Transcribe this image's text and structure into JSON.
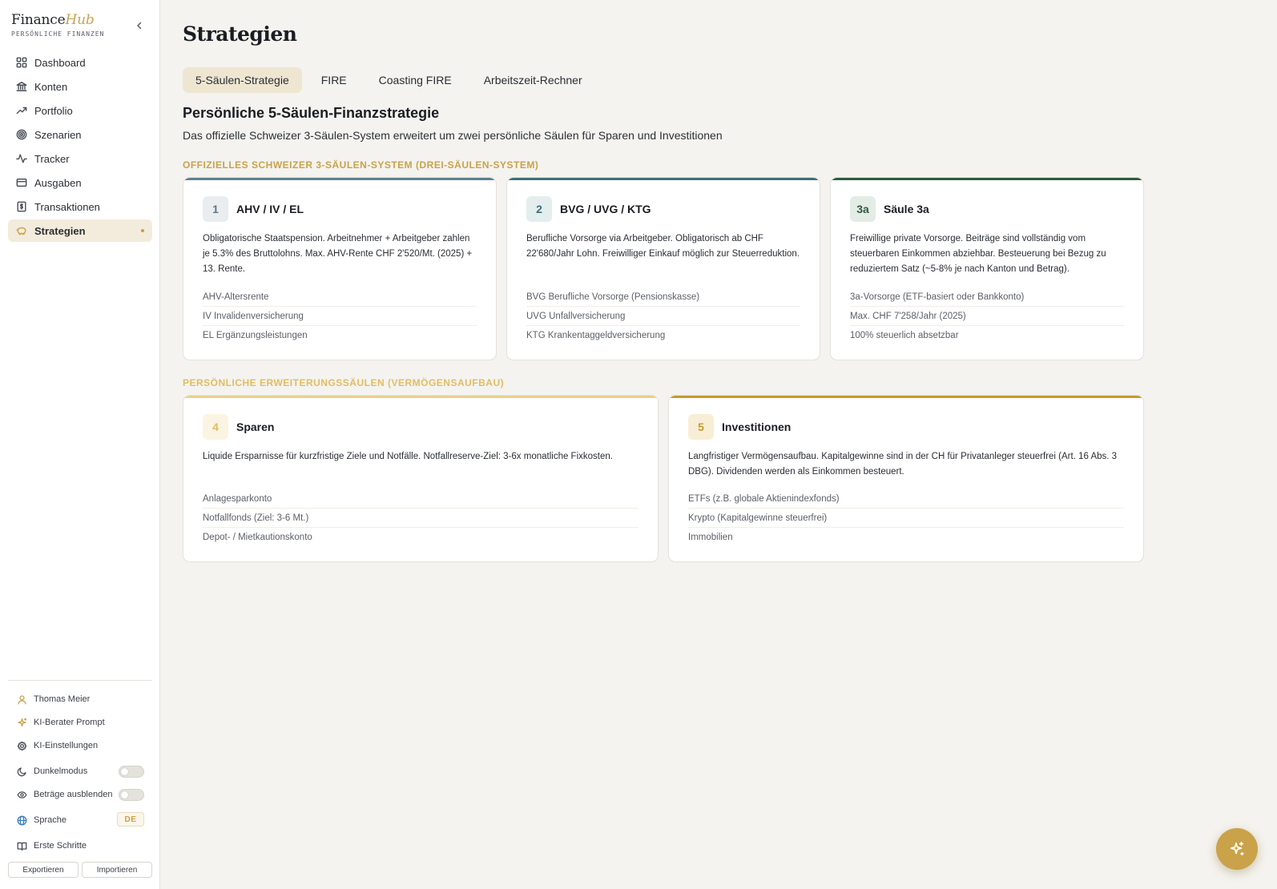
{
  "brand": {
    "name_plain": "Finance",
    "name_accent": "Hub",
    "tagline": "PERSÖNLICHE FINANZEN"
  },
  "nav": [
    {
      "label": "Dashboard",
      "icon": "dashboard-icon"
    },
    {
      "label": "Konten",
      "icon": "bank-icon"
    },
    {
      "label": "Portfolio",
      "icon": "trending-up-icon"
    },
    {
      "label": "Szenarien",
      "icon": "target-icon"
    },
    {
      "label": "Tracker",
      "icon": "activity-icon"
    },
    {
      "label": "Ausgaben",
      "icon": "credit-card-icon"
    },
    {
      "label": "Transaktionen",
      "icon": "receipt-icon"
    },
    {
      "label": "Strategien",
      "icon": "piggy-bank-icon",
      "active": true
    }
  ],
  "sidebar_bottom": {
    "user": "Thomas Meier",
    "ai_prompt": "KI-Berater Prompt",
    "ai_settings": "KI-Einstellungen",
    "dark_mode": "Dunkelmodus",
    "hide_amounts": "Beträge ausblenden",
    "language": "Sprache",
    "language_value": "DE",
    "getting_started": "Erste Schritte",
    "export": "Exportieren",
    "import": "Importieren"
  },
  "page": {
    "title": "Strategien",
    "tabs": [
      "5-Säulen-Strategie",
      "FIRE",
      "Coasting FIRE",
      "Arbeitszeit-Rechner"
    ],
    "active_tab": "5-Säulen-Strategie",
    "section_title": "Persönliche 5-Säulen-Finanzstrategie",
    "section_subtitle": "Das offizielle Schweizer 3-Säulen-System erweitert um zwei persönliche Säulen für Sparen und Investitionen"
  },
  "groups": {
    "official_label": "OFFIZIELLES SCHWEIZER 3-SÄULEN-SYSTEM (DREI-SÄULEN-SYSTEM)",
    "personal_label": "PERSÖNLICHE ERWEITERUNGSSÄULEN (VERMÖGENSAUFBAU)"
  },
  "pillars": [
    {
      "badge": "1",
      "title": "AHV / IV / EL",
      "description": "Obligatorische Staatspension. Arbeitnehmer + Arbeitgeber zahlen je 5.3% des Bruttolohns. Max. AHV-Rente CHF 2'520/Mt. (2025) + 13. Rente.",
      "items": [
        "AHV-Altersrente",
        "IV Invalidenversicherung",
        "EL Ergänzungsleistungen"
      ],
      "accent": "#5f8090",
      "badge_bg": "#e9edf0",
      "badge_fg": "#5f7785"
    },
    {
      "badge": "2",
      "title": "BVG / UVG / KTG",
      "description": "Berufliche Vorsorge via Arbeitgeber. Obligatorisch ab CHF 22'680/Jahr Lohn. Freiwilliger Einkauf möglich zur Steuerreduktion.",
      "items": [
        "BVG Berufliche Vorsorge (Pensionskasse)",
        "UVG Unfallversicherung",
        "KTG Krankentaggeldversicherung"
      ],
      "accent": "#3d6e78",
      "badge_bg": "#e5eeee",
      "badge_fg": "#3d6e78"
    },
    {
      "badge": "3a",
      "title": "Säule 3a",
      "description": "Freiwillige private Vorsorge. Beiträge sind vollständig vom steuerbaren Einkommen abziehbar. Besteuerung bei Bezug zu reduziertem Satz (~5-8% je nach Kanton und Betrag).",
      "items": [
        "3a-Vorsorge (ETF-basiert oder Bankkonto)",
        "Max. CHF 7'258/Jahr (2025)",
        "100% steuerlich absetzbar"
      ],
      "accent": "#2f5a3e",
      "badge_bg": "#e4ece6",
      "badge_fg": "#2f5a3e"
    },
    {
      "badge": "4",
      "title": "Sparen",
      "description": "Liquide Ersparnisse für kurzfristige Ziele und Notfälle. Notfallreserve-Ziel: 3-6x monatliche Fixkosten.",
      "items": [
        "Anlagesparkonto",
        "Notfallfonds (Ziel: 3-6 Mt.)",
        "Depot- / Mietkautionskonto"
      ],
      "accent": "#ead08a",
      "badge_bg": "#fbf4e2",
      "badge_fg": "#e0bd64"
    },
    {
      "badge": "5",
      "title": "Investitionen",
      "description": "Langfristiger Vermögensaufbau. Kapitalgewinne sind in der CH für Privatanleger steuerfrei (Art. 16 Abs. 3 DBG). Dividenden werden als Einkommen besteuert.",
      "items": [
        "ETFs (z.B. globale Aktienindexfonds)",
        "Krypto (Kapitalgewinne steuerfrei)",
        "Immobilien"
      ],
      "accent": "#c9992f",
      "badge_bg": "#f8eed6",
      "badge_fg": "#c9992f"
    }
  ],
  "fab": {
    "icon": "sparkles-icon"
  }
}
